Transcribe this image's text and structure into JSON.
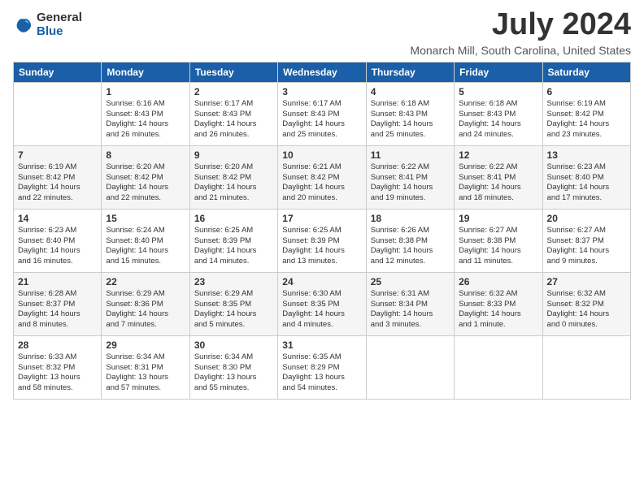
{
  "logo": {
    "general": "General",
    "blue": "Blue"
  },
  "title": "July 2024",
  "subtitle": "Monarch Mill, South Carolina, United States",
  "header": {
    "days": [
      "Sunday",
      "Monday",
      "Tuesday",
      "Wednesday",
      "Thursday",
      "Friday",
      "Saturday"
    ]
  },
  "weeks": [
    [
      {
        "day": "",
        "content": ""
      },
      {
        "day": "1",
        "content": "Sunrise: 6:16 AM\nSunset: 8:43 PM\nDaylight: 14 hours\nand 26 minutes."
      },
      {
        "day": "2",
        "content": "Sunrise: 6:17 AM\nSunset: 8:43 PM\nDaylight: 14 hours\nand 26 minutes."
      },
      {
        "day": "3",
        "content": "Sunrise: 6:17 AM\nSunset: 8:43 PM\nDaylight: 14 hours\nand 25 minutes."
      },
      {
        "day": "4",
        "content": "Sunrise: 6:18 AM\nSunset: 8:43 PM\nDaylight: 14 hours\nand 25 minutes."
      },
      {
        "day": "5",
        "content": "Sunrise: 6:18 AM\nSunset: 8:43 PM\nDaylight: 14 hours\nand 24 minutes."
      },
      {
        "day": "6",
        "content": "Sunrise: 6:19 AM\nSunset: 8:42 PM\nDaylight: 14 hours\nand 23 minutes."
      }
    ],
    [
      {
        "day": "7",
        "content": "Sunrise: 6:19 AM\nSunset: 8:42 PM\nDaylight: 14 hours\nand 22 minutes."
      },
      {
        "day": "8",
        "content": "Sunrise: 6:20 AM\nSunset: 8:42 PM\nDaylight: 14 hours\nand 22 minutes."
      },
      {
        "day": "9",
        "content": "Sunrise: 6:20 AM\nSunset: 8:42 PM\nDaylight: 14 hours\nand 21 minutes."
      },
      {
        "day": "10",
        "content": "Sunrise: 6:21 AM\nSunset: 8:42 PM\nDaylight: 14 hours\nand 20 minutes."
      },
      {
        "day": "11",
        "content": "Sunrise: 6:22 AM\nSunset: 8:41 PM\nDaylight: 14 hours\nand 19 minutes."
      },
      {
        "day": "12",
        "content": "Sunrise: 6:22 AM\nSunset: 8:41 PM\nDaylight: 14 hours\nand 18 minutes."
      },
      {
        "day": "13",
        "content": "Sunrise: 6:23 AM\nSunset: 8:40 PM\nDaylight: 14 hours\nand 17 minutes."
      }
    ],
    [
      {
        "day": "14",
        "content": "Sunrise: 6:23 AM\nSunset: 8:40 PM\nDaylight: 14 hours\nand 16 minutes."
      },
      {
        "day": "15",
        "content": "Sunrise: 6:24 AM\nSunset: 8:40 PM\nDaylight: 14 hours\nand 15 minutes."
      },
      {
        "day": "16",
        "content": "Sunrise: 6:25 AM\nSunset: 8:39 PM\nDaylight: 14 hours\nand 14 minutes."
      },
      {
        "day": "17",
        "content": "Sunrise: 6:25 AM\nSunset: 8:39 PM\nDaylight: 14 hours\nand 13 minutes."
      },
      {
        "day": "18",
        "content": "Sunrise: 6:26 AM\nSunset: 8:38 PM\nDaylight: 14 hours\nand 12 minutes."
      },
      {
        "day": "19",
        "content": "Sunrise: 6:27 AM\nSunset: 8:38 PM\nDaylight: 14 hours\nand 11 minutes."
      },
      {
        "day": "20",
        "content": "Sunrise: 6:27 AM\nSunset: 8:37 PM\nDaylight: 14 hours\nand 9 minutes."
      }
    ],
    [
      {
        "day": "21",
        "content": "Sunrise: 6:28 AM\nSunset: 8:37 PM\nDaylight: 14 hours\nand 8 minutes."
      },
      {
        "day": "22",
        "content": "Sunrise: 6:29 AM\nSunset: 8:36 PM\nDaylight: 14 hours\nand 7 minutes."
      },
      {
        "day": "23",
        "content": "Sunrise: 6:29 AM\nSunset: 8:35 PM\nDaylight: 14 hours\nand 5 minutes."
      },
      {
        "day": "24",
        "content": "Sunrise: 6:30 AM\nSunset: 8:35 PM\nDaylight: 14 hours\nand 4 minutes."
      },
      {
        "day": "25",
        "content": "Sunrise: 6:31 AM\nSunset: 8:34 PM\nDaylight: 14 hours\nand 3 minutes."
      },
      {
        "day": "26",
        "content": "Sunrise: 6:32 AM\nSunset: 8:33 PM\nDaylight: 14 hours\nand 1 minute."
      },
      {
        "day": "27",
        "content": "Sunrise: 6:32 AM\nSunset: 8:32 PM\nDaylight: 14 hours\nand 0 minutes."
      }
    ],
    [
      {
        "day": "28",
        "content": "Sunrise: 6:33 AM\nSunset: 8:32 PM\nDaylight: 13 hours\nand 58 minutes."
      },
      {
        "day": "29",
        "content": "Sunrise: 6:34 AM\nSunset: 8:31 PM\nDaylight: 13 hours\nand 57 minutes."
      },
      {
        "day": "30",
        "content": "Sunrise: 6:34 AM\nSunset: 8:30 PM\nDaylight: 13 hours\nand 55 minutes."
      },
      {
        "day": "31",
        "content": "Sunrise: 6:35 AM\nSunset: 8:29 PM\nDaylight: 13 hours\nand 54 minutes."
      },
      {
        "day": "",
        "content": ""
      },
      {
        "day": "",
        "content": ""
      },
      {
        "day": "",
        "content": ""
      }
    ]
  ]
}
